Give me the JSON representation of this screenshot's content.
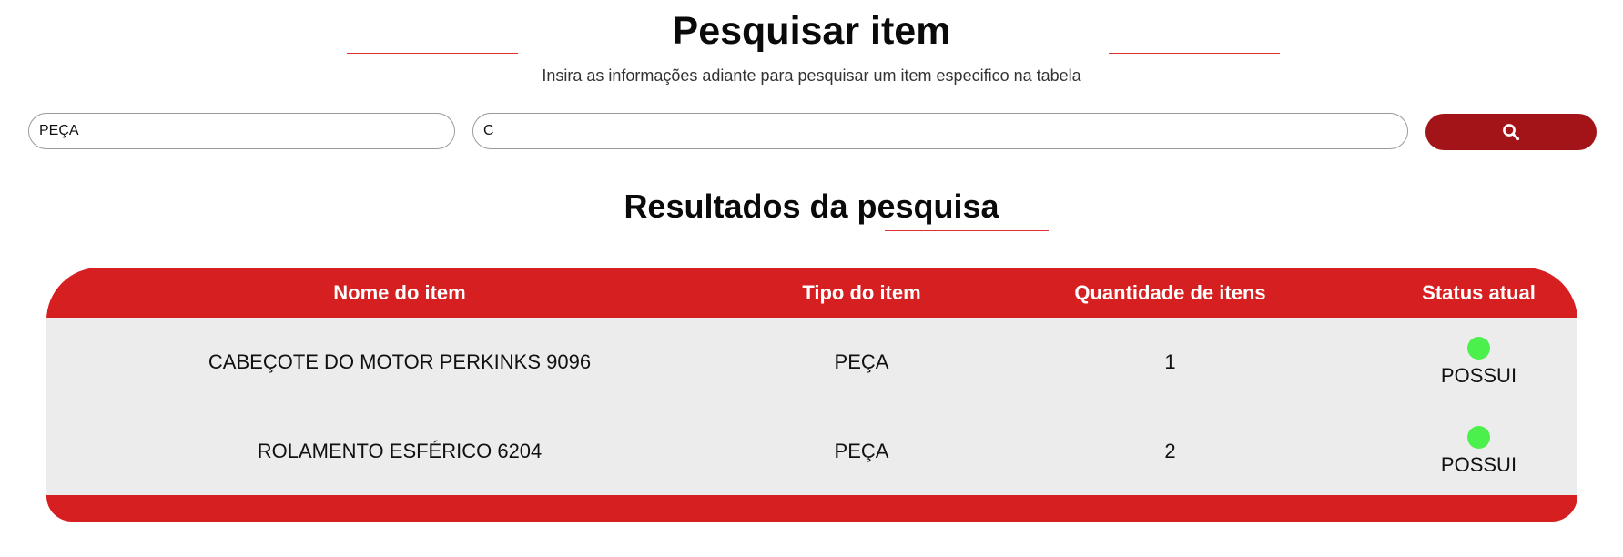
{
  "header": {
    "title": "Pesquisar item",
    "subtitle": "Insira as informações adiante para pesquisar um item especifico na tabela"
  },
  "search": {
    "type_value": "PEÇA",
    "query_value": "C",
    "button_icon": "search-icon"
  },
  "results": {
    "title": "Resultados da pesquisa",
    "columns": [
      "Nome do item",
      "Tipo do item",
      "Quantidade de itens",
      "Status atual"
    ],
    "rows": [
      {
        "name": "CABEÇOTE DO MOTOR PERKINKS 9096",
        "type": "PEÇA",
        "quantity": "1",
        "status": "POSSUI"
      },
      {
        "name": "ROLAMENTO ESFÉRICO 6204",
        "type": "PEÇA",
        "quantity": "2",
        "status": "POSSUI"
      }
    ]
  },
  "colors": {
    "accent": "#d51f20",
    "button": "#a31419",
    "row_background": "#ececec",
    "status_available": "#4cf04c"
  }
}
